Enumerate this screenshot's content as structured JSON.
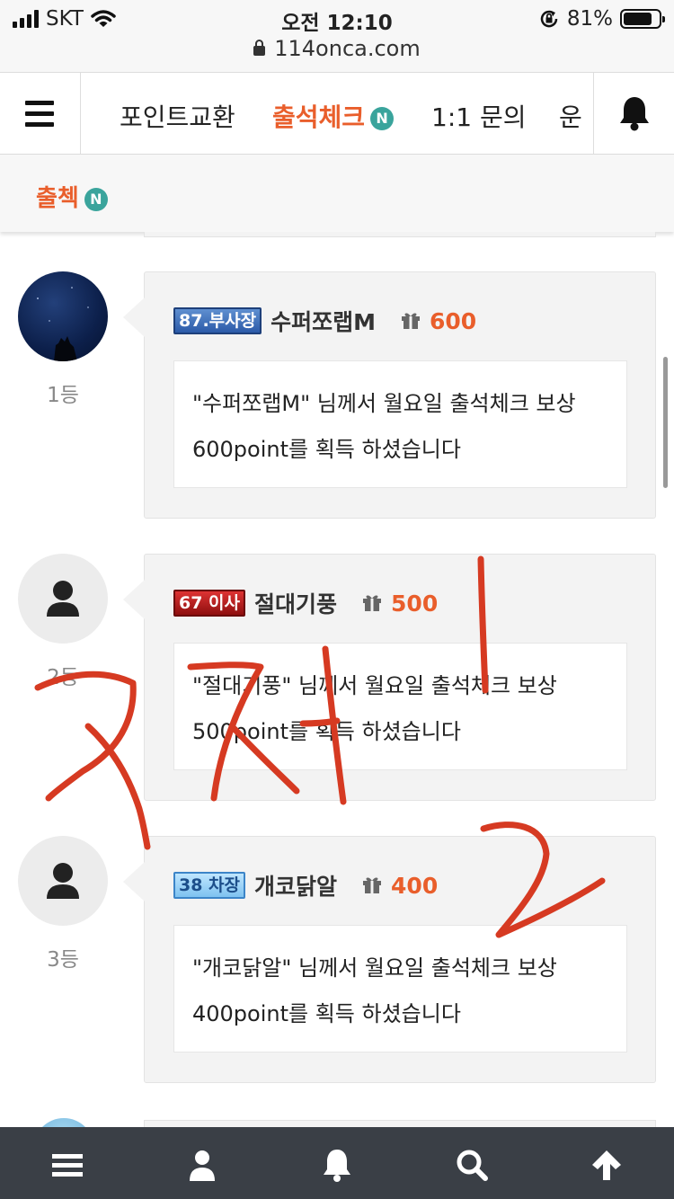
{
  "status_bar": {
    "carrier": "SKT",
    "time": "오전 12:10",
    "battery": "81%",
    "url": "114onca.com"
  },
  "top_nav": {
    "tabs": [
      {
        "label": "포인트교환",
        "active": false
      },
      {
        "label": "출석체크",
        "active": true,
        "badge": "N"
      },
      {
        "label": "1:1 문의",
        "active": false
      },
      {
        "label": "운",
        "active": false
      }
    ]
  },
  "sub_nav": {
    "label": "출첵",
    "badge": "N"
  },
  "entries": [
    {
      "rank": "1등",
      "level": "87.부사장",
      "nickname": "수퍼쪼랩M",
      "points": "600",
      "line1": "\"수퍼쪼랩M\" 님께서 월요일 출석체크 보상",
      "line2": "600point를 획득 하셨습니다"
    },
    {
      "rank": "2등",
      "level": "67 이사",
      "nickname": "절대기풍",
      "points": "500",
      "line1": "\"절대기풍\" 님께서 월요일 출석체크 보상",
      "line2": "500point를 획득 하셨습니다"
    },
    {
      "rank": "3등",
      "level": "38 차장",
      "nickname": "개코닭알",
      "points": "400",
      "line1": "\"개코닭알\" 님께서 월요일 출석체크 보상",
      "line2": "400point를 획득 하셨습니다"
    }
  ],
  "colors": {
    "accent": "#e95e2b",
    "badge": "#3aa49c",
    "bottom_bar": "#3a3f46",
    "annotation": "#d63a22"
  },
  "bottom_bar": {
    "icons": [
      "menu-icon",
      "user-icon",
      "bell-icon",
      "search-icon",
      "arrow-up-icon"
    ]
  }
}
